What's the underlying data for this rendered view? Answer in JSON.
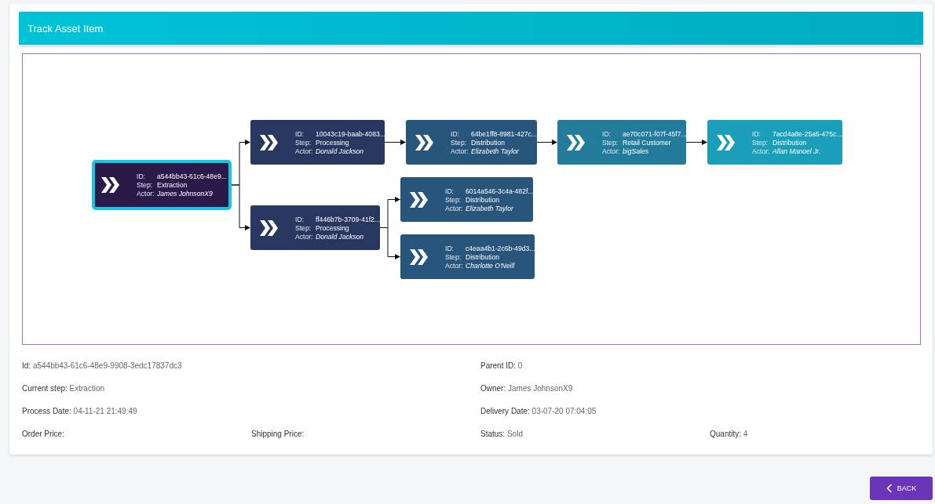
{
  "header": {
    "title": "Track Asset Item"
  },
  "diagram": {
    "nodes": [
      {
        "id_label": "ID:",
        "id": "a544bb43-61c6-48e9...",
        "step_label": "Step:",
        "step": "Extraction",
        "actor_label": "Actor:",
        "actor": "James JohnsonX9",
        "color": "#2a1a4a",
        "selected": true
      },
      {
        "id_label": "ID:",
        "id": "10043c19-baab-4083...",
        "step_label": "Step:",
        "step": "Processing",
        "actor_label": "Actor:",
        "actor": "Donald Jackson",
        "color": "#283760",
        "selected": false
      },
      {
        "id_label": "ID:",
        "id": "ff446b7b-3709-41f2...",
        "step_label": "Step:",
        "step": "Processing",
        "actor_label": "Actor:",
        "actor": "Donald Jackson",
        "color": "#283760",
        "selected": false
      },
      {
        "id_label": "ID:",
        "id": "64be1ff8-8981-427c...",
        "step_label": "Step:",
        "step": "Distribution",
        "actor_label": "Actor:",
        "actor": "Elizabeth Taylor",
        "color": "#27557b",
        "selected": false
      },
      {
        "id_label": "ID:",
        "id": "ae70c071-f07f-45f7...",
        "step_label": "Step:",
        "step": "Retail Customer",
        "actor_label": "Actor:",
        "actor": "bigSales",
        "color": "#237b9b",
        "selected": false
      },
      {
        "id_label": "ID:",
        "id": "7acd4a8e-25a5-475c...",
        "step_label": "Step:",
        "step": "Distribution",
        "actor_label": "Actor:",
        "actor": "Allan Manoel Jr.",
        "color": "#1b9eb9",
        "selected": false
      },
      {
        "id_label": "ID:",
        "id": "6014a546-3c4a-482f...",
        "step_label": "Step:",
        "step": "Distribution",
        "actor_label": "Actor:",
        "actor": "Elizabeth Taylor",
        "color": "#27557b",
        "selected": false
      },
      {
        "id_label": "ID:",
        "id": "c4eaa4b1-2c6b-49d3...",
        "step_label": "Step:",
        "step": "Distribution",
        "actor_label": "Actor:",
        "actor": "Charlotte O'Neill",
        "color": "#27557b",
        "selected": false
      }
    ]
  },
  "details": [
    [
      {
        "label": "Id:",
        "value": "a544bb43-61c6-48e9-9908-3edc17837dc3"
      },
      {
        "label": "Parent ID:",
        "value": "0"
      }
    ],
    [
      {
        "label": "Current step:",
        "value": "Extraction"
      },
      {
        "label": "Owner:",
        "value": "James JohnsonX9"
      }
    ],
    [
      {
        "label": "Process Date:",
        "value": "04-11-21 21:49:49"
      },
      {
        "label": "Delivery Date:",
        "value": "03-07-20 07:04:05"
      }
    ],
    [
      {
        "label": "Order Price:"
      },
      {
        "label": "Shipping Price:"
      },
      {
        "label": "Status:",
        "value": "Sold"
      },
      {
        "label": "Quantity:",
        "value": "4"
      }
    ]
  ],
  "back_button": {
    "label": "BACK"
  }
}
